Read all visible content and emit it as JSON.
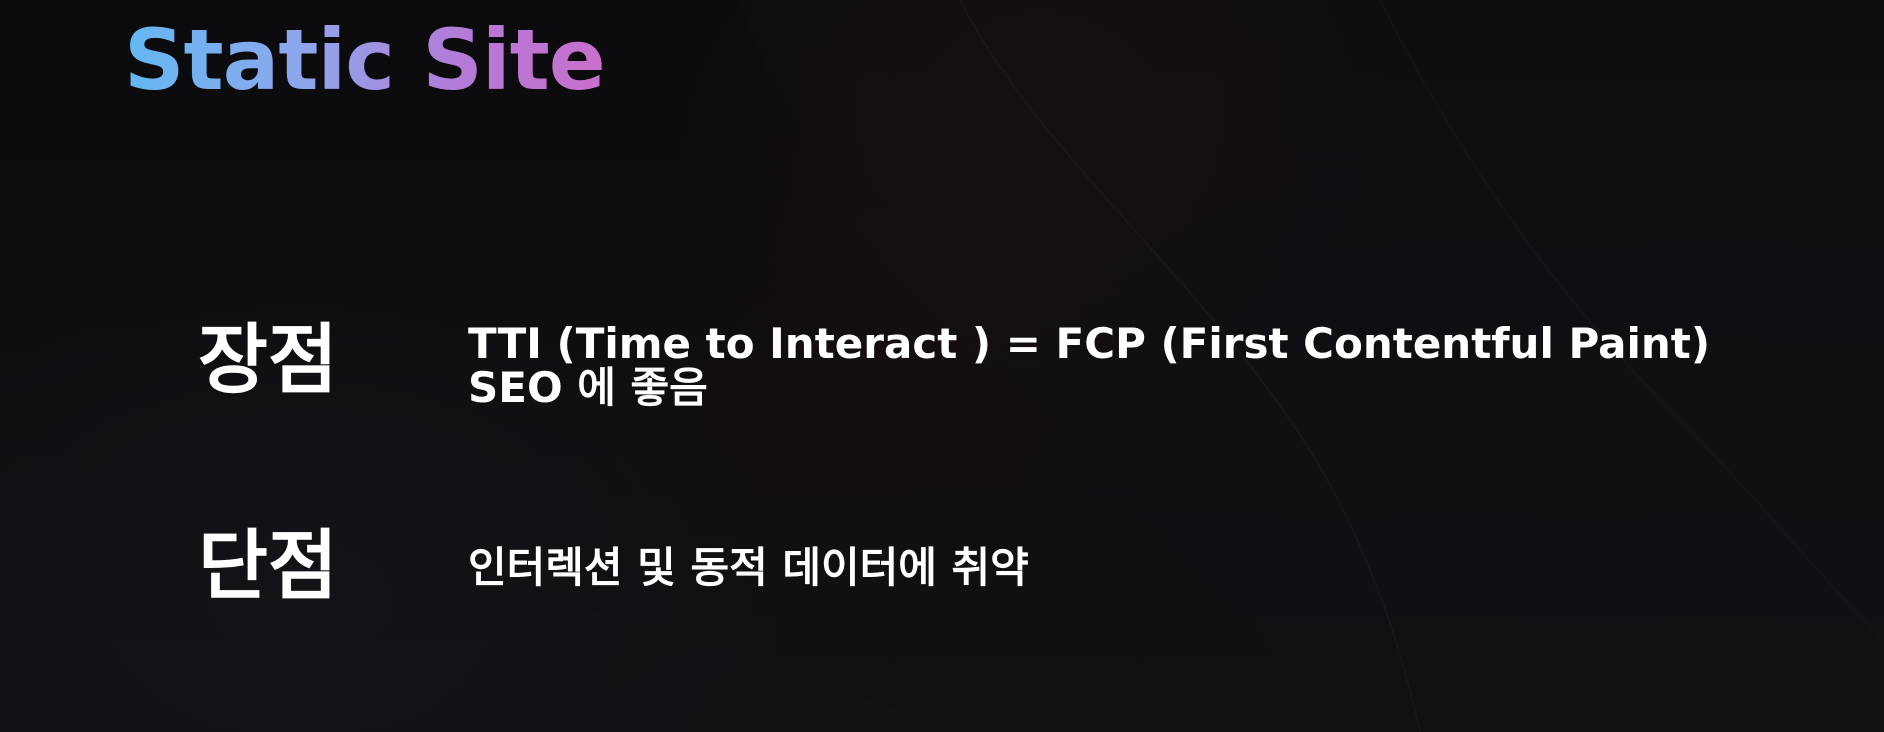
{
  "slide": {
    "title": "Static Site",
    "pros": {
      "label": "장점",
      "items": [
        "TTI (Time to Interact ) = FCP (First Contentful Paint)",
        "SEO 에 좋음"
      ]
    },
    "cons": {
      "label": "단점",
      "items": [
        "인터렉션 및 동적 데이터에 취약"
      ]
    }
  },
  "colors": {
    "background": "#0c0c0e",
    "title_gradient_start": "#63b8f2",
    "title_gradient_end": "#c96fcc",
    "text": "#ffffff"
  }
}
